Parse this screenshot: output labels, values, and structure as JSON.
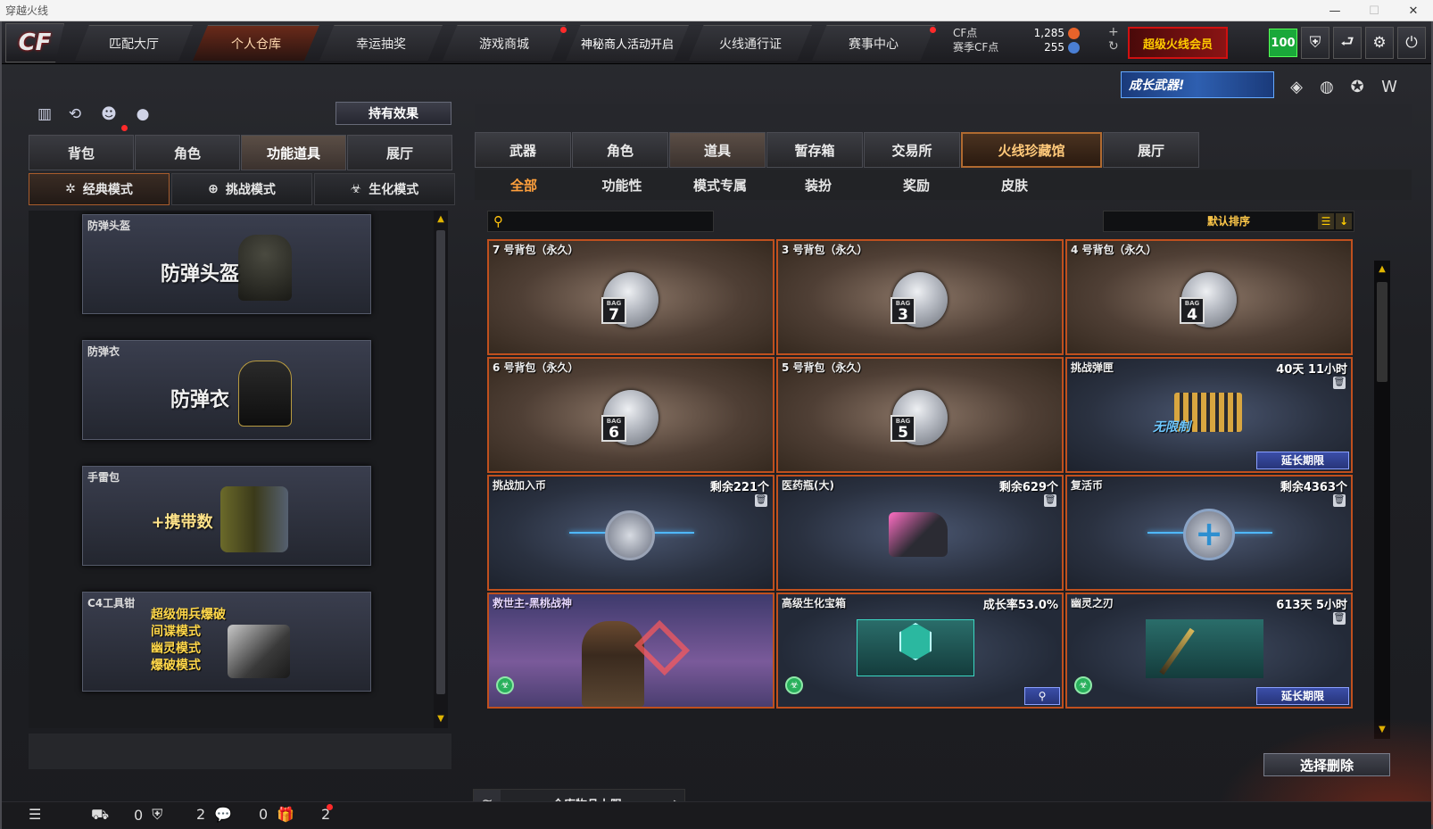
{
  "window": {
    "title": "穿越火线",
    "min": "—",
    "max": "☐",
    "close": "✕"
  },
  "nav": {
    "tabs": [
      "匹配大厅",
      "个人仓库",
      "幸运抽奖",
      "游戏商城",
      "神秘商人活动开启",
      "火线通行证",
      "赛事中心"
    ],
    "active_index": 1
  },
  "points": {
    "cf_label": "CF点",
    "cf_value": "1,285",
    "season_label": "赛季CF点",
    "season_value": "255"
  },
  "vip_text": "超级火线会员",
  "level": "100",
  "grow_banner": "成长武器!",
  "left": {
    "effect_button": "持有效果",
    "tabs": [
      "背包",
      "角色",
      "功能道具",
      "展厅"
    ],
    "active_tab": 2,
    "modes": [
      "经典模式",
      "挑战模式",
      "生化模式"
    ],
    "items": [
      {
        "label": "防弹头盔",
        "big": "防弹头盔"
      },
      {
        "label": "防弹衣",
        "big": "防弹衣"
      },
      {
        "label": "手雷包",
        "big": "+携带数"
      },
      {
        "label": "C4工具钳",
        "lines": [
          "超级佣兵爆破",
          "间谍模式",
          "幽灵模式",
          "爆破模式"
        ]
      }
    ]
  },
  "right": {
    "tabs": [
      "武器",
      "角色",
      "道具",
      "暂存箱",
      "交易所",
      "火线珍藏馆",
      "展厅"
    ],
    "active_tab": 2,
    "subtabs": [
      "全部",
      "功能性",
      "模式专属",
      "装扮",
      "奖励",
      "皮肤"
    ],
    "active_sub": 0,
    "sort_label": "默认排序",
    "items": [
      {
        "title": "7 号背包（永久）",
        "right": "",
        "bag": "7"
      },
      {
        "title": "3 号背包（永久）",
        "right": "",
        "bag": "3"
      },
      {
        "title": "4 号背包（永久）",
        "right": "",
        "bag": "4"
      },
      {
        "title": "6 号背包（永久）",
        "right": "",
        "bag": "6"
      },
      {
        "title": "5 号背包（永久）",
        "right": "",
        "bag": "5"
      },
      {
        "title": "挑战弹匣",
        "right": "40天 11小时",
        "extend": "延长期限",
        "badge": "无限制"
      },
      {
        "title": "挑战加入币",
        "right": "剩余221个"
      },
      {
        "title": "医药瓶(大)",
        "right": "剩余629个"
      },
      {
        "title": "复活币",
        "right": "剩余4363个"
      },
      {
        "title": "救世主-黑桃战神",
        "right": ""
      },
      {
        "title": "高级生化宝箱",
        "right": "成长率53.0%"
      },
      {
        "title": "幽灵之刃",
        "right": "613天 5小时",
        "extend": "延长期限"
      }
    ],
    "delete_button": "选择删除",
    "capacity_label": "仓库物品上限"
  },
  "status": {
    "c1": "0",
    "c2": "2",
    "c3": "0",
    "c4": "2"
  },
  "icons": [
    "menu-icon",
    "binoculars-icon",
    "shield-icon",
    "chat-icon",
    "gift-icon",
    "gear-icon",
    "power-icon",
    "search-icon"
  ],
  "colors": {
    "accent_orange": "#ffa03c",
    "card_border": "#c0501e",
    "level_green": "#1aa83a"
  }
}
